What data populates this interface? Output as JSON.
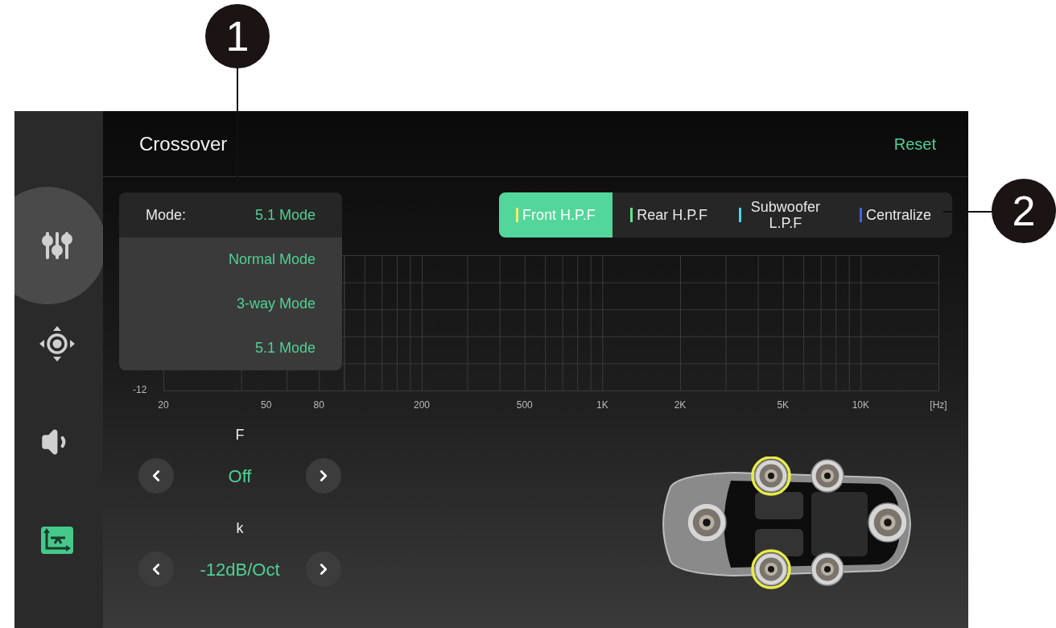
{
  "callouts": [
    {
      "label": "1"
    },
    {
      "label": "2"
    }
  ],
  "sidebar": {
    "items": [
      {
        "kind": "sliders",
        "selected": true,
        "highlighted": false
      },
      {
        "kind": "position",
        "selected": false,
        "highlighted": false
      },
      {
        "kind": "speaker",
        "selected": false,
        "highlighted": false
      },
      {
        "kind": "crossover",
        "selected": false,
        "highlighted": true
      }
    ]
  },
  "header": {
    "title": "Crossover",
    "action": "Reset"
  },
  "mode": {
    "label": "Mode:",
    "value": "5.1 Mode",
    "expanded": true,
    "options": [
      "Normal Mode",
      "3-way Mode",
      "5.1 Mode"
    ]
  },
  "filters": [
    {
      "label": "Front H.P.F",
      "color": "#f2ea6c",
      "selected": true
    },
    {
      "label": "Rear H.P.F",
      "color": "#5fe38d",
      "selected": false
    },
    {
      "label": "Subwoofer L.P.F",
      "color": "#3fd8ea",
      "selected": false
    },
    {
      "label": "Centralize",
      "color": "#3d63ea",
      "selected": false
    }
  ],
  "graph": {
    "y_label": "-12",
    "x_labels": [
      "20",
      "50",
      "80",
      "200",
      "500",
      "1K",
      "2K",
      "5K",
      "10K",
      "[Hz]"
    ]
  },
  "controls": [
    {
      "label": "F",
      "value": "Off"
    },
    {
      "label": "k",
      "value": "-12dB/Oct"
    }
  ],
  "speakers": [
    {
      "active": true
    },
    {
      "active": false
    },
    {
      "active": false
    },
    {
      "active": false
    },
    {
      "active": true
    },
    {
      "active": false
    }
  ]
}
